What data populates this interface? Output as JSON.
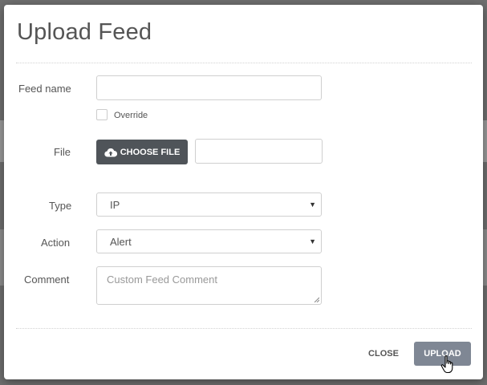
{
  "dialog": {
    "title": "Upload Feed"
  },
  "form": {
    "feed_name": {
      "label": "Feed name",
      "value": ""
    },
    "override": {
      "label": "Override",
      "checked": false
    },
    "file": {
      "label": "File",
      "button_label": "CHOOSE FILE",
      "button_icon": "cloud-upload-icon",
      "value": ""
    },
    "type": {
      "label": "Type",
      "selected": "IP"
    },
    "action": {
      "label": "Action",
      "selected": "Alert"
    },
    "comment": {
      "label": "Comment",
      "placeholder": "Custom Feed Comment"
    }
  },
  "footer": {
    "close_label": "CLOSE",
    "upload_label": "UPLOAD"
  },
  "colors": {
    "backdrop": "#6f6f6f",
    "choose_file_button": "#4f5459",
    "upload_button": "#7f8794",
    "title_text": "#555555"
  }
}
